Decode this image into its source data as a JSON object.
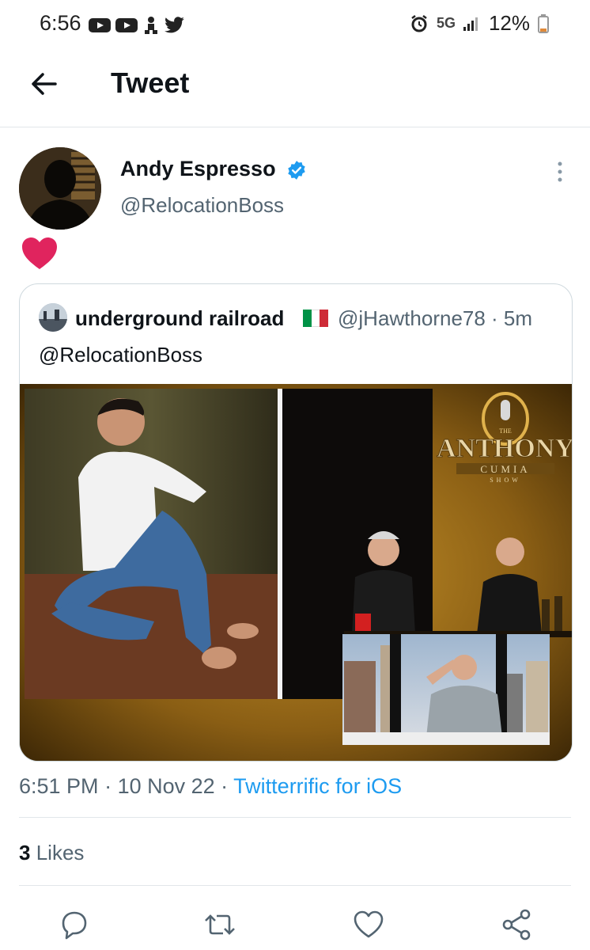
{
  "status_bar": {
    "time": "6:56",
    "network": "5G",
    "battery": "12%",
    "icons": [
      "youtube-icon",
      "youtube-icon",
      "notification-icon",
      "twitter-bird-icon",
      "alarm-icon",
      "signal-icon",
      "battery-icon"
    ]
  },
  "header": {
    "title": "Tweet"
  },
  "author": {
    "name": "Andy Espresso",
    "handle": "@RelocationBoss",
    "verified": true
  },
  "tweet": {
    "content_icon": "heart-emoji"
  },
  "quote": {
    "name": "underground railroad",
    "handle": "@jHawthorne78",
    "age": "5m",
    "meta": "@jHawthorne78 · 5m",
    "text": "@RelocationBoss",
    "media": {
      "logo_text": "ANTHONY",
      "logo_sub": "CUMIA",
      "logo_top": "THE",
      "logo_bottom": "SHOW"
    }
  },
  "footer": {
    "time": "6:51 PM",
    "date": "10 Nov 22",
    "source": "Twitterrific for iOS",
    "likes_count": "3",
    "likes_label": "Likes"
  },
  "colors": {
    "accent": "#1d9bf0",
    "heart": "#e0245e",
    "text_secondary": "#536471"
  }
}
